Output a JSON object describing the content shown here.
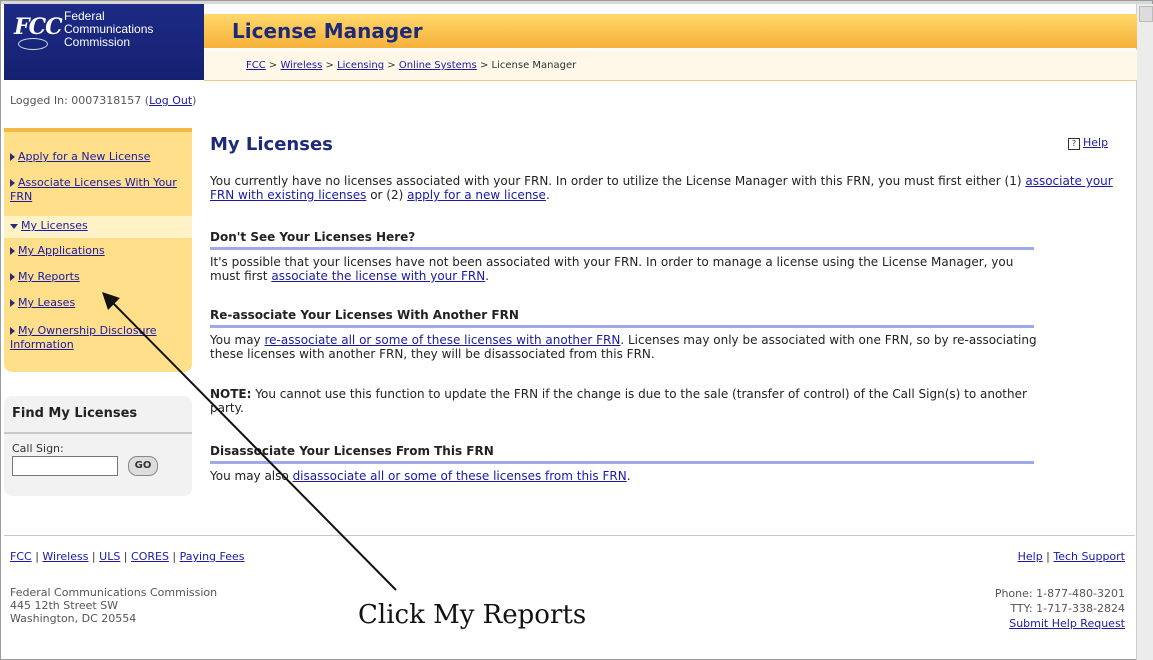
{
  "header": {
    "logo_mark": "FCC",
    "logo_lines": [
      "Federal",
      "Communications",
      "Commission"
    ],
    "title": "License Manager",
    "breadcrumb": [
      "FCC",
      "Wireless",
      "Licensing",
      "Online Systems",
      "License Manager"
    ]
  },
  "session": {
    "logged_in_label": "Logged In: 0007318157 (",
    "logout_link": "Log Out",
    "logged_in_suffix": ")"
  },
  "sidebar": {
    "items": [
      {
        "label": "Apply for a New License",
        "selected": false
      },
      {
        "label": "Associate Licenses With Your FRN",
        "selected": false
      },
      {
        "label": "My Licenses",
        "selected": true
      },
      {
        "label": "My Applications",
        "selected": false
      },
      {
        "label": "My Reports",
        "selected": false
      },
      {
        "label": "My Leases",
        "selected": false
      },
      {
        "label": "My Ownership Disclosure Information",
        "selected": false
      }
    ]
  },
  "find": {
    "title": "Find My Licenses",
    "call_sign_label": "Call Sign:",
    "call_sign_value": "",
    "go_label": "GO"
  },
  "main": {
    "title": "My Licenses",
    "help_label": "Help",
    "intro_pre": "You currently have no licenses associated with your FRN. In order to utilize the License Manager with this FRN, you must first either (1) ",
    "intro_link1": "associate your FRN with existing licenses",
    "intro_mid": " or (2) ",
    "intro_link2": "apply for a new license",
    "intro_post": ".",
    "sections": [
      {
        "heading": "Don't See Your Licenses Here?",
        "pre": "It's possible that your licenses have not been associated with your FRN. In order to manage a license using the License Manager, you must first ",
        "link": "associate the license with your FRN",
        "post": "."
      },
      {
        "heading": "Re-associate Your Licenses With Another FRN",
        "pre": "You may ",
        "link": "re-associate all or some of these licenses with another FRN",
        "post": ". Licenses may only be associated with one FRN, so by re-associating these licenses with another FRN, they will be disassociated from this FRN."
      },
      {
        "note_label": "NOTE:",
        "note_text": " You cannot use this function to update the FRN if the change is due to the sale (transfer of control) of the Call Sign(s) to another party."
      },
      {
        "heading": "Disassociate Your Licenses From This FRN",
        "pre": "You may also ",
        "link": "disassociate all or some of these licenses from this FRN",
        "post": "."
      }
    ]
  },
  "footer": {
    "links": [
      "FCC",
      "Wireless",
      "ULS",
      "CORES",
      "Paying Fees"
    ],
    "right_links": [
      "Help",
      "Tech Support"
    ],
    "address": [
      "Federal Communications Commission",
      "445 12th Street SW",
      "Washington, DC 20554"
    ],
    "phone": "Phone: 1-877-480-3201",
    "tty": "TTY: 1-717-338-2824",
    "submit_link": "Submit Help Request"
  },
  "annotation": {
    "text": "Click My Reports"
  }
}
